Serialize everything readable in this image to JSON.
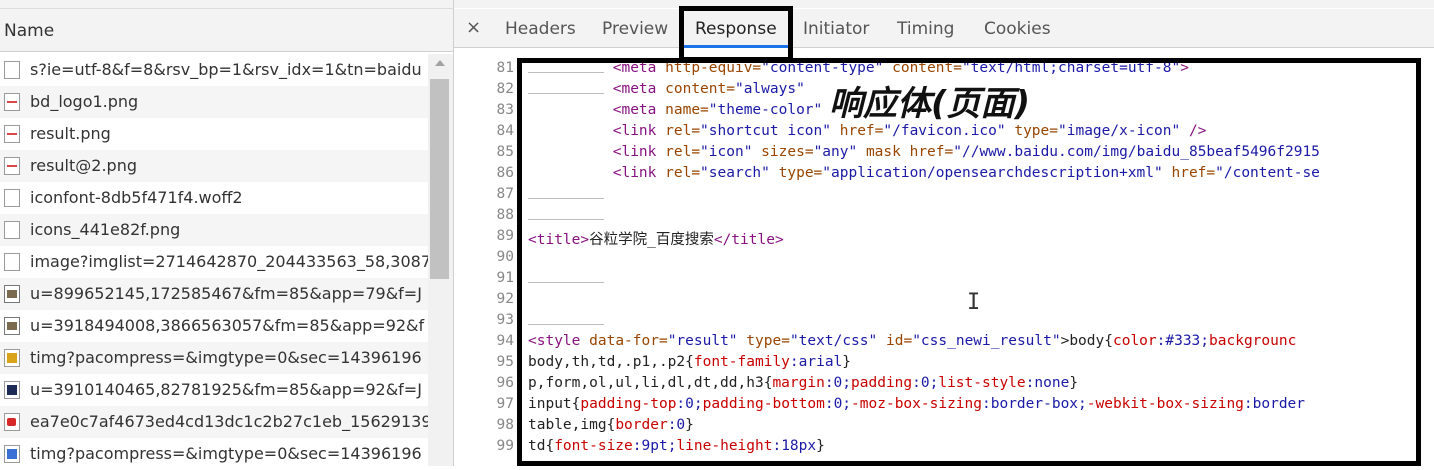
{
  "left_panel": {
    "header": "Name",
    "requests": [
      {
        "name": "s?ie=utf-8&f=8&rsv_bp=1&rsv_idx=1&tn=baidu",
        "icon": "document-icon"
      },
      {
        "name": "bd_logo1.png",
        "icon": "image-file-icon"
      },
      {
        "name": "result.png",
        "icon": "image-file-icon"
      },
      {
        "name": "result@2.png",
        "icon": "image-file-icon"
      },
      {
        "name": "iconfont-8db5f471f4.woff2",
        "icon": "file-icon"
      },
      {
        "name": "icons_441e82f.png",
        "icon": "file-icon"
      },
      {
        "name": "image?imglist=2714642870_204433563_58,3087",
        "icon": "document-icon"
      },
      {
        "name": "u=899652145,172585467&fm=85&app=79&f=J",
        "icon": "image-thumb-icon"
      },
      {
        "name": "u=3918494008,3866563057&fm=85&app=92&f",
        "icon": "image-thumb-icon"
      },
      {
        "name": "timg?pacompress=&imgtype=0&sec=14396196",
        "icon": "image-thumb-icon"
      },
      {
        "name": "u=3910140465,82781925&fm=85&app=92&f=J",
        "icon": "image-thumb-icon"
      },
      {
        "name": "ea7e0c7af4673ed4cd13dc1c2b27c1eb_15629139",
        "icon": "image-thumb-icon"
      },
      {
        "name": "timg?pacompress=&imgtype=0&sec=14396196",
        "icon": "image-thumb-icon"
      }
    ]
  },
  "tabs": {
    "close": "×",
    "headers": "Headers",
    "preview": "Preview",
    "response": "Response",
    "initiator": "Initiator",
    "timing": "Timing",
    "cookies": "Cookies"
  },
  "annotation": "响应体(页面)",
  "code": {
    "line_numbers": [
      "81",
      "82",
      "83",
      "84",
      "85",
      "86",
      "87",
      "88",
      "89",
      "90",
      "91",
      "92",
      "93",
      "94",
      "95",
      "96",
      "97",
      "98",
      "99"
    ],
    "l81_tag": "<meta",
    "l81_attr1": "http-equiv=",
    "l81_val1": "\"content-type\"",
    "l81_attr2": "content=",
    "l81_val2": "\"text/html;charset=utf-8\"",
    "l81_end": ">",
    "l82_tag": "<meta",
    "l82_attr1": "content=",
    "l82_val1": "\"always\"",
    "l83_tag": "<meta",
    "l83_attr1": "name=",
    "l83_val1": "\"theme-color\"",
    "l84_tag": "<link",
    "l84_a1": "rel=",
    "l84_v1": "\"shortcut icon\"",
    "l84_a2": "href=",
    "l84_v2": "\"/favicon.ico\"",
    "l84_a3": "type=",
    "l84_v3": "\"image/x-icon\"",
    "l84_end": "/>",
    "l85_tag": "<link",
    "l85_a1": "rel=",
    "l85_v1": "\"icon\"",
    "l85_a2": "sizes=",
    "l85_v2": "\"any\"",
    "l85_a3": "mask href=",
    "l85_v3": "\"//www.baidu.com/img/baidu_85beaf5496f2915",
    "l86_tag": "<link",
    "l86_a1": "rel=",
    "l86_v1": "\"search\"",
    "l86_a2": "type=",
    "l86_v2": "\"application/opensearchdescription+xml\"",
    "l86_a3": "href=",
    "l86_v3": "\"/content-se",
    "l89_open": "<title>",
    "l89_text": "谷粒学院_百度搜索",
    "l89_close": "</title>",
    "l94_tag": "<style",
    "l94_a1": "data-for=",
    "l94_v1": "\"result\"",
    "l94_a2": "type=",
    "l94_v2": "\"text/css\"",
    "l94_a3": "id=",
    "l94_v3": "\"css_newi_result\"",
    "l94_rest_sel": ">body{",
    "l94_p1": "color",
    "l94_v4": ":#333;",
    "l94_p2": "backgrounc",
    "l95_sel": "body,th,td,.p1,.p2{",
    "l95_p": "font-family",
    "l95_v": ":arial",
    "l95_end": "}",
    "l96_sel": "p,form,ol,ul,li,dl,dt,dd,h3{",
    "l96_p1": "margin",
    "l96_v1": ":0;",
    "l96_p2": "padding",
    "l96_v2": ":0;",
    "l96_p3": "list-style",
    "l96_v3": ":none",
    "l96_end": "}",
    "l97_sel": "input{",
    "l97_p1": "padding-top",
    "l97_v1": ":0;",
    "l97_p2": "padding-bottom",
    "l97_v2": ":0;",
    "l97_p3": "-moz-box-sizing",
    "l97_v3": ":border-box;",
    "l97_p4": "-webkit-box-sizing",
    "l97_v4": ":border",
    "l98_sel": "table,img{",
    "l98_p": "border",
    "l98_v": ":0",
    "l98_end": "}",
    "l99_sel": "td{",
    "l99_p1": "font-size",
    "l99_v1": ":9pt;",
    "l99_p2": "line-height",
    "l99_v2": ":18px",
    "l99_end": "}"
  },
  "colors": {
    "tag": "#881280",
    "attr_name": "#994500",
    "attr_value": "#1a1aa6",
    "css_prop": "#c80000",
    "active_tab_underline": "#1a73e8"
  }
}
